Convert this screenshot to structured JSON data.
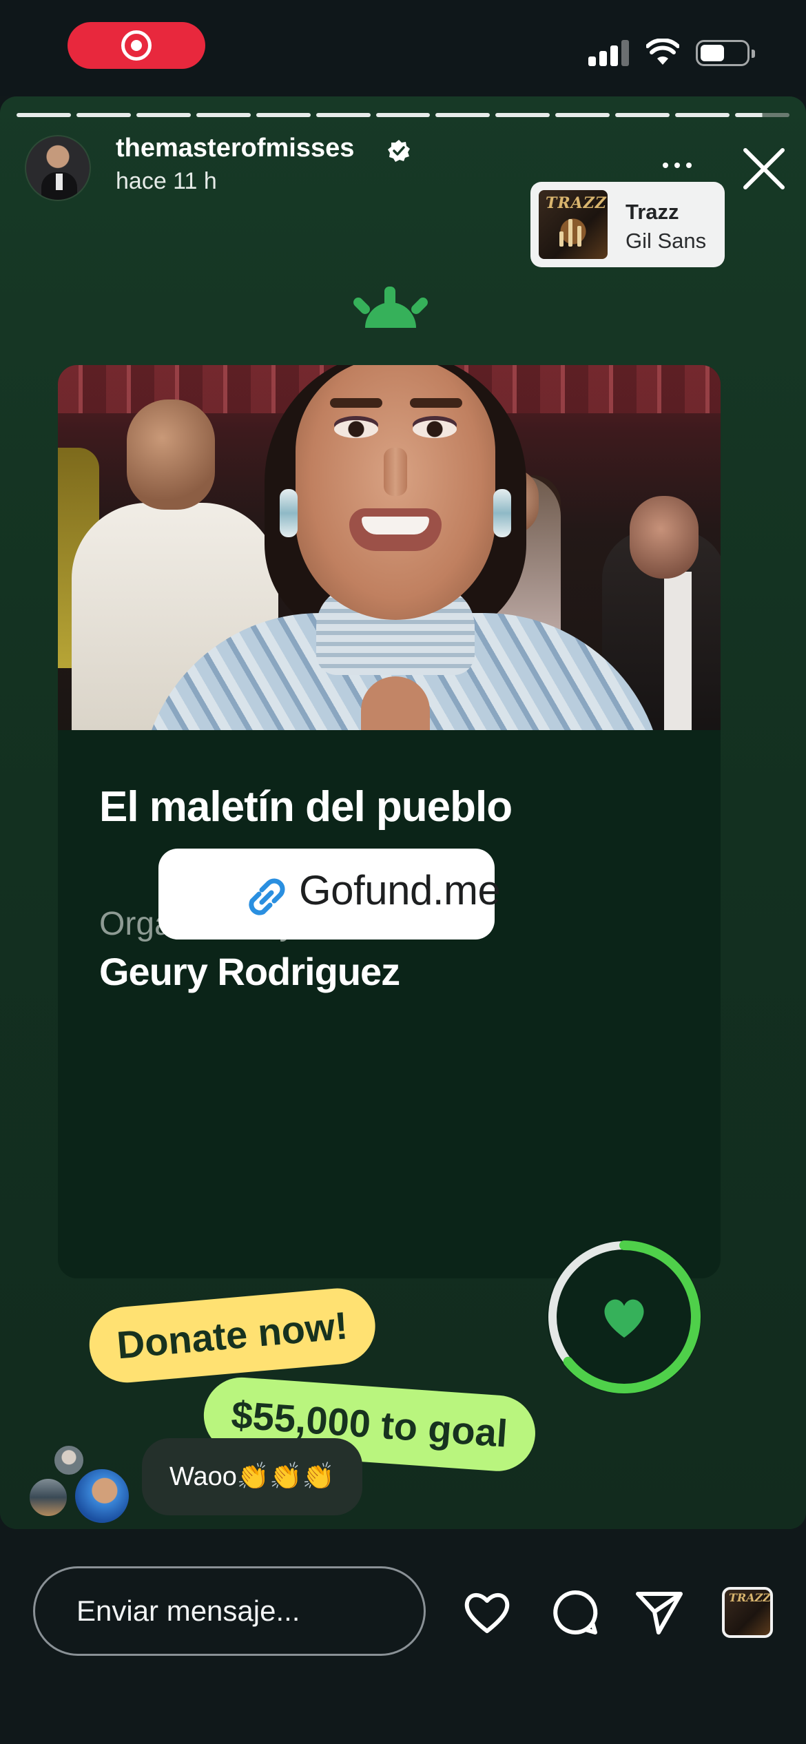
{
  "story": {
    "progress_segments": 13,
    "username": "themasterofmisses",
    "time_ago": "hace 11 h",
    "music": {
      "title": "Trazz",
      "artist": "Gil Sans",
      "cover_text": "TRAZZ"
    }
  },
  "fundraiser": {
    "title": "El maletín del pueblo",
    "organized_label": "Organized by",
    "organizer": "Geury Rodriguez",
    "link_label": "Gofund.me",
    "donate_label": "Donate now!",
    "goal_label": "$55,000 to goal",
    "brand_color": "#36b15a"
  },
  "reaction": {
    "comment": "Waoo👏👏👏"
  },
  "bottom_bar": {
    "message_placeholder": "Enviar mensaje..."
  },
  "colors": {
    "accent_red": "#e8283d",
    "donate_tag": "#ffe172",
    "goal_tag": "#b9f57e",
    "card_bg": "#0b2418"
  }
}
